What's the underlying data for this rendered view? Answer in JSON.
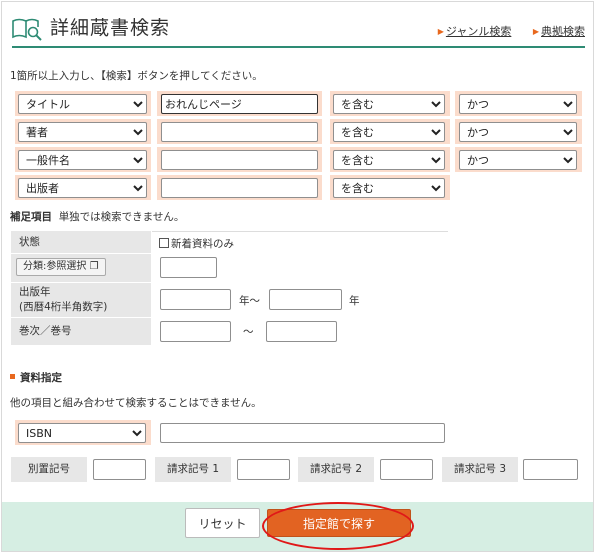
{
  "header": {
    "title": "詳細蔵書検索",
    "links": [
      "ジャンル検索",
      "典拠検索"
    ]
  },
  "intro": "1箇所以上入力し、【検索】ボタンを押してください。",
  "conditions": [
    {
      "field": "タイトル",
      "value": "おれんじページ",
      "match": "を含む",
      "logic": "かつ"
    },
    {
      "field": "著者",
      "value": "",
      "match": "を含む",
      "logic": "かつ"
    },
    {
      "field": "一般件名",
      "value": "",
      "match": "を含む",
      "logic": "かつ"
    },
    {
      "field": "出版者",
      "value": "",
      "match": "を含む"
    }
  ],
  "supplement": {
    "heading": "補足項目",
    "note": "単独では検索できません。",
    "status_label": "状態",
    "new_only": "新着資料のみ",
    "bunrui_button": "分類:参照選択",
    "pubyear_label_1": "出版年",
    "pubyear_label_2": "(西暦4桁半角数字)",
    "year_from": "年～",
    "year_to": "年",
    "volume_label": "巻次／巻号",
    "tilde": "～"
  },
  "material": {
    "heading": "資料指定",
    "note": "他の項目と組み合わせて検索することはできません。",
    "type": "ISBN",
    "codes": [
      "別置記号",
      "請求記号 1",
      "請求記号 2",
      "請求記号 3"
    ]
  },
  "footer": {
    "reset": "リセット",
    "search": "指定館で探す"
  },
  "colors": {
    "accent": "#2e8b74",
    "orange": "#e26322",
    "pink": "#fbdccc",
    "footer_bg": "#d6eee3",
    "highlight": "#e01818"
  }
}
